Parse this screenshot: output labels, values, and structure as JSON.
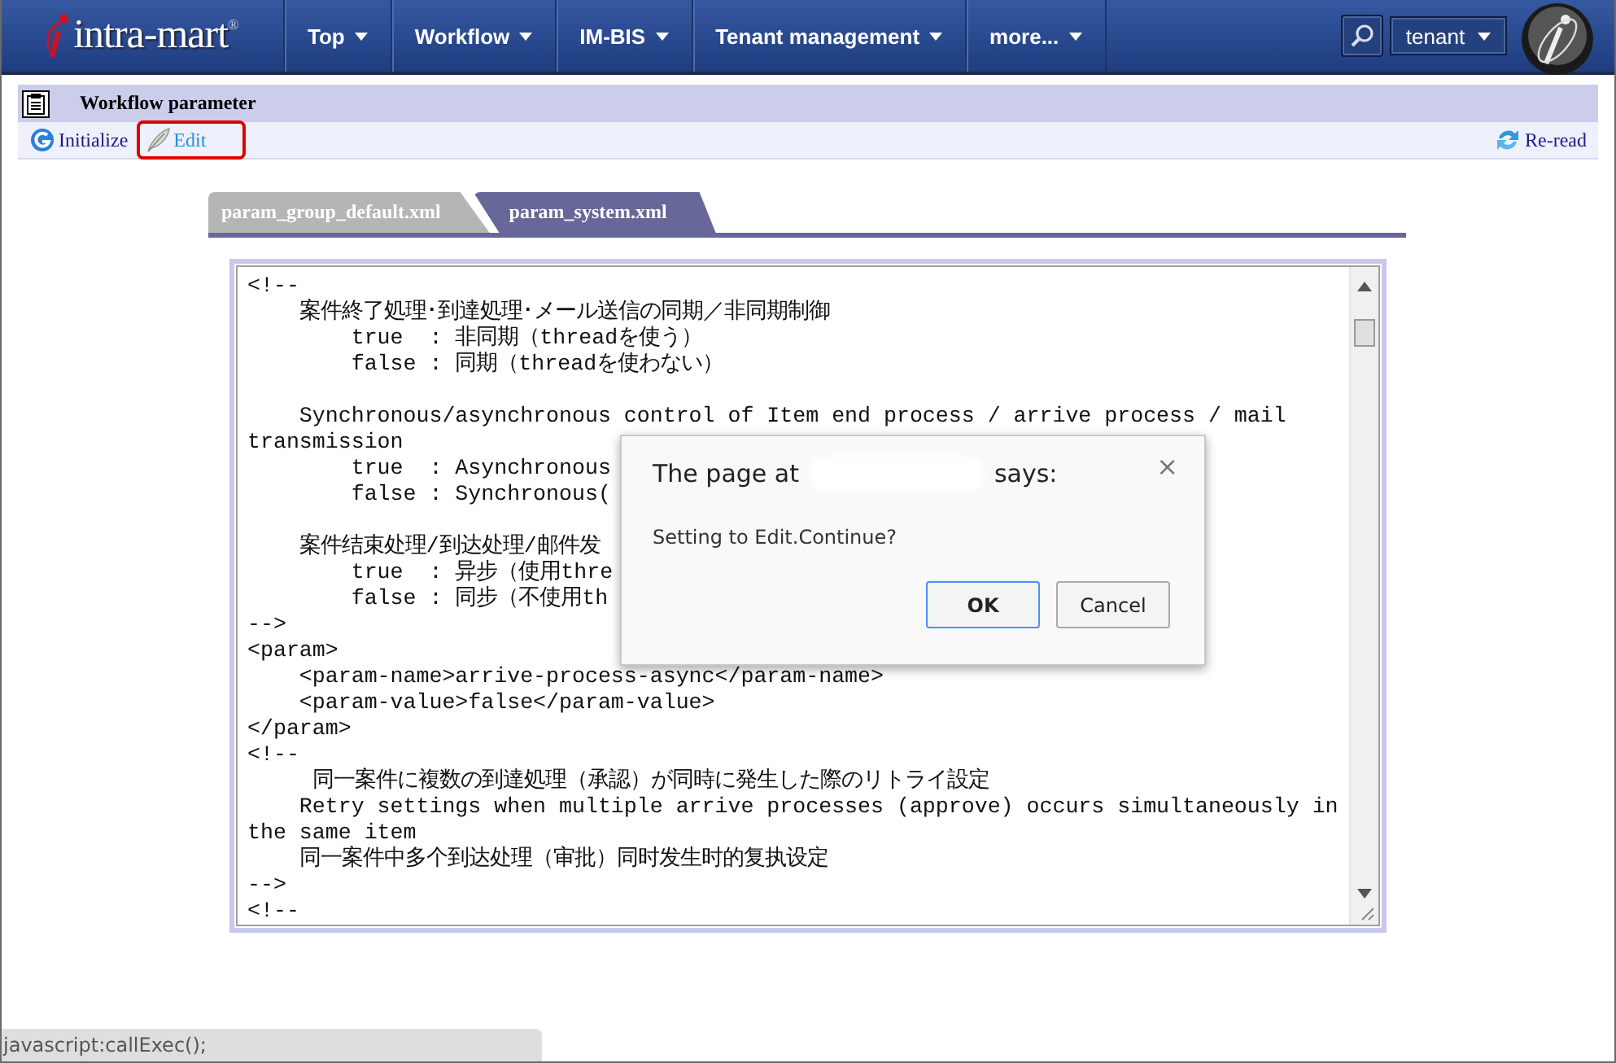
{
  "header": {
    "logo": "intra-mart",
    "logo_mark": "®",
    "nav": [
      {
        "label": "Top"
      },
      {
        "label": "Workflow"
      },
      {
        "label": "IM-BIS"
      },
      {
        "label": "Tenant management"
      },
      {
        "label": "more..."
      }
    ],
    "tenant": "tenant"
  },
  "page_title": "Workflow parameter",
  "toolbar": {
    "left": [
      {
        "label": "Initialize",
        "kind": "initialize",
        "highlighted": false
      },
      {
        "label": "Edit",
        "kind": "edit",
        "highlighted": true
      }
    ],
    "right": [
      {
        "label": "Re-read",
        "kind": "reload",
        "highlighted": false
      }
    ]
  },
  "tabs": [
    {
      "label": "param_group_default.xml",
      "selected": false
    },
    {
      "label": "param_system.xml",
      "selected": true
    }
  ],
  "code_blocks": [
    {
      "lines": [
        "<!--",
        "    案件終了処理･到達処理･メール送信の同期／非同期制御",
        "        true  : 非同期（threadを使う）",
        "        false : 同期（threadを使わない）"
      ]
    },
    {
      "lines": [
        "    Synchronous/asynchronous control of Item end process / arrive process / mail",
        "transmission",
        "        true  : Asynchronous",
        "        false : Synchronous("
      ]
    },
    {
      "lines": [
        "    案件结束处理/到达处理/邮件发",
        "        true  : 异步（使用thre",
        "        false : 同步（不使用th",
        "-->",
        "<param>",
        "    <param-name>arrive-process-async</param-name>",
        "    <param-value>false</param-value>",
        "</param>",
        "<!--",
        "     同一案件に複数の到達処理（承認）が同時に発生した際のリトライ設定",
        "    Retry settings when multiple arrive processes (approve) occurs simultaneously in",
        "the same item",
        "    同一案件中多个到达处理（审批）同时发生时的复执设定",
        "-->",
        "<!--"
      ]
    }
  ],
  "dialog": {
    "title_start": "The page at",
    "title_end": "says:",
    "close": "×",
    "message": "Setting to Edit.Continue?",
    "buttons": [
      {
        "label": "OK",
        "kind": "primary"
      },
      {
        "label": "Cancel",
        "kind": "secondary"
      }
    ]
  },
  "status_bar": "javascript:callExec();"
}
